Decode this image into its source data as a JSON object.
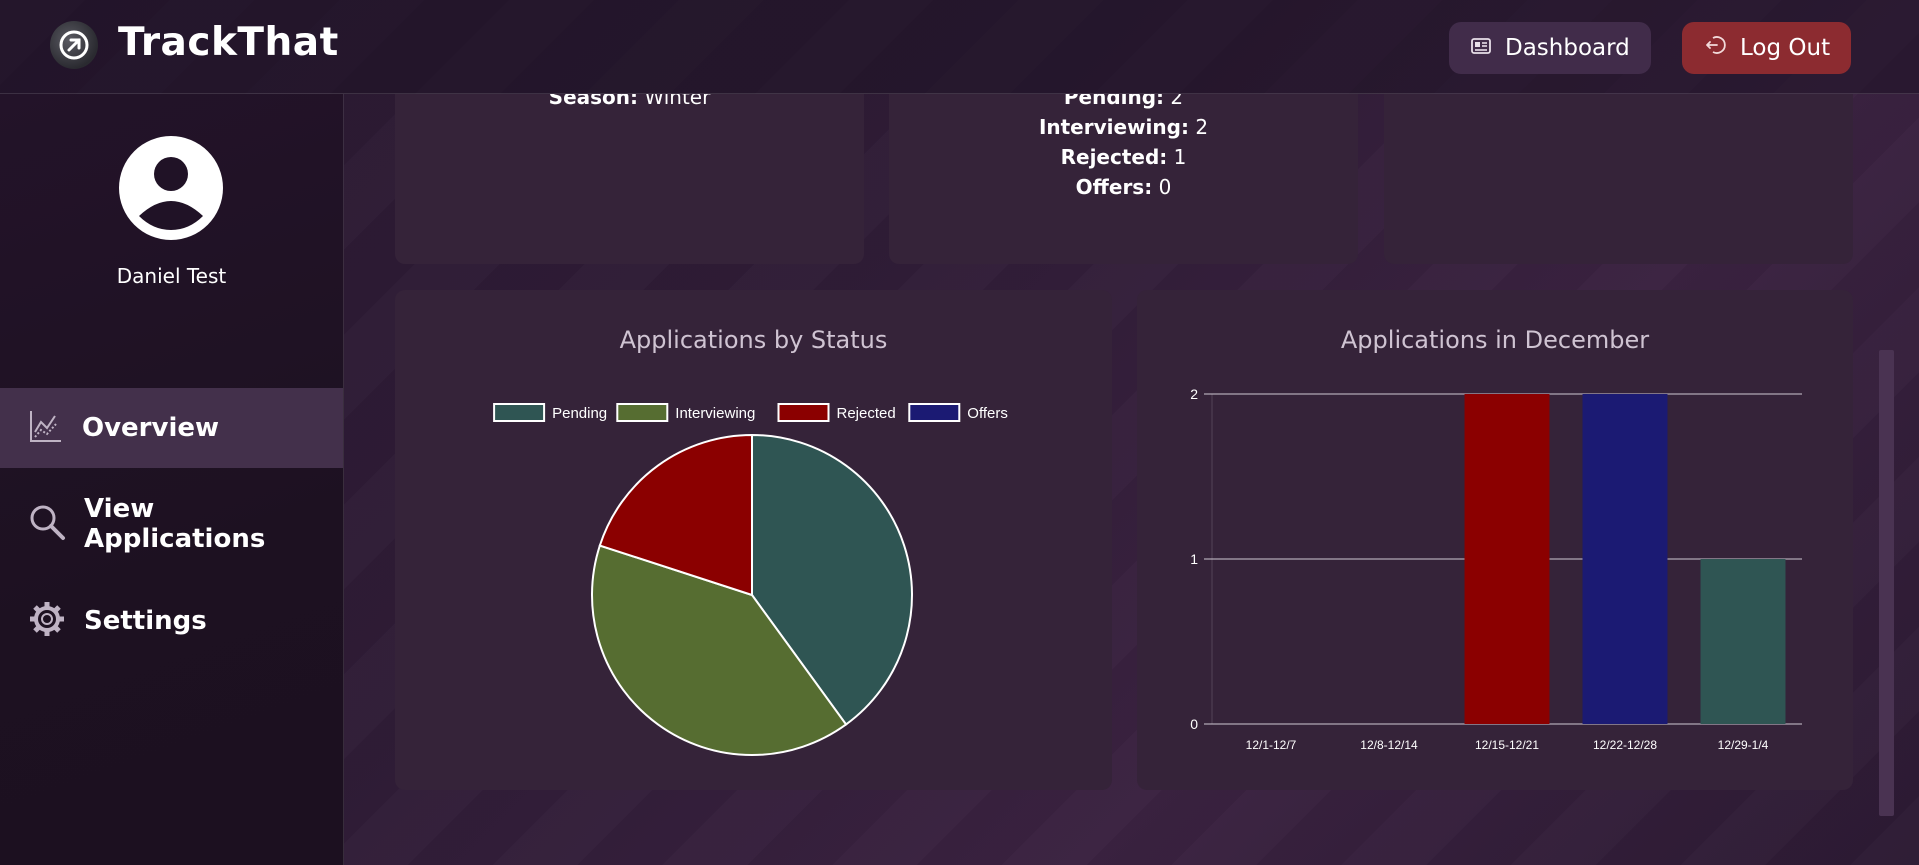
{
  "app": {
    "title": "TrackThat"
  },
  "header": {
    "dashboard_label": "Dashboard",
    "logout_label": "Log Out"
  },
  "sidebar": {
    "username": "Daniel Test",
    "items": [
      {
        "label": "Overview",
        "icon": "chart-icon",
        "active": true
      },
      {
        "label": "View Applications",
        "icon": "search-icon",
        "active": false
      },
      {
        "label": "Settings",
        "icon": "gear-icon",
        "active": false
      }
    ]
  },
  "info_cards": {
    "card1": {
      "season_label": "Season:",
      "season_value": "Winter"
    },
    "card2": {
      "pending_label": "Pending:",
      "pending_value": "2",
      "interviewing_label": "Interviewing:",
      "interviewing_value": "2",
      "rejected_label": "Rejected:",
      "rejected_value": "1",
      "offers_label": "Offers:",
      "offers_value": "0"
    }
  },
  "colors": {
    "pending": "#2f5553",
    "interviewing": "#566d31",
    "rejected": "#8b0000",
    "offers": "#1b1a73",
    "logout": "#8c2b30"
  },
  "chart_data": [
    {
      "type": "pie",
      "title": "Applications by Status",
      "categories": [
        "Pending",
        "Interviewing",
        "Rejected",
        "Offers"
      ],
      "values": [
        2,
        2,
        1,
        0
      ],
      "colors": [
        "#2f5553",
        "#566d31",
        "#8b0000",
        "#1b1a73"
      ],
      "legend": "top"
    },
    {
      "type": "bar",
      "title": "Applications in December",
      "categories": [
        "12/1-12/7",
        "12/8-12/14",
        "12/15-12/21",
        "12/22-12/28",
        "12/29-1/4"
      ],
      "values": [
        0,
        0,
        2,
        2,
        1
      ],
      "colors": [
        "#2f5553",
        "#566d31",
        "#8b0000",
        "#1b1a73",
        "#2f5553"
      ],
      "ylim": [
        0,
        2
      ],
      "yticks": [
        0,
        1,
        2
      ],
      "grid": true
    }
  ]
}
